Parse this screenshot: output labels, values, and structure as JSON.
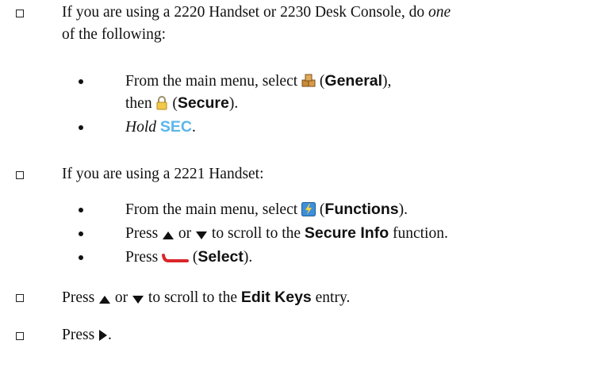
{
  "step1": {
    "line1": "If you are using a 2220 Handset or 2230 Desk Console, do ",
    "line1_em": "one",
    "line2": "of the following:",
    "b1": {
      "pre": "From the main menu, select ",
      "open": " (",
      "bold": "General",
      "close": "),",
      "then": "then ",
      "bold2": "Secure",
      "close2": ")."
    },
    "b2": {
      "em": "Hold",
      "key": "SEC",
      "post": "."
    }
  },
  "step2": {
    "line1": "If you are using a 2221 Handset:",
    "b1": {
      "pre": "From the main menu, select ",
      "bold": "Functions",
      "post": ")."
    },
    "b2": {
      "pre": "Press ",
      "or": " or ",
      "mid": " to scroll to the ",
      "bold": "Secure Info",
      "post": " function."
    },
    "b3": {
      "pre": "Press ",
      "bold": "Select",
      "post": ")."
    }
  },
  "step3": {
    "pre": "Press ",
    "or": " or ",
    "mid": " to scroll to the ",
    "bold": "Edit Keys",
    "post": " entry."
  },
  "step4": {
    "pre": "Press ",
    "post": "."
  },
  "colors": {
    "sec_key": "#5bb6ea",
    "select_softkey": "#d9262b"
  },
  "icons": [
    "checkbox-icon",
    "general-boxes-icon",
    "padlock-icon",
    "functions-lightning-icon",
    "up-arrow-icon",
    "down-arrow-icon",
    "red-softkey-icon",
    "right-arrow-icon"
  ]
}
